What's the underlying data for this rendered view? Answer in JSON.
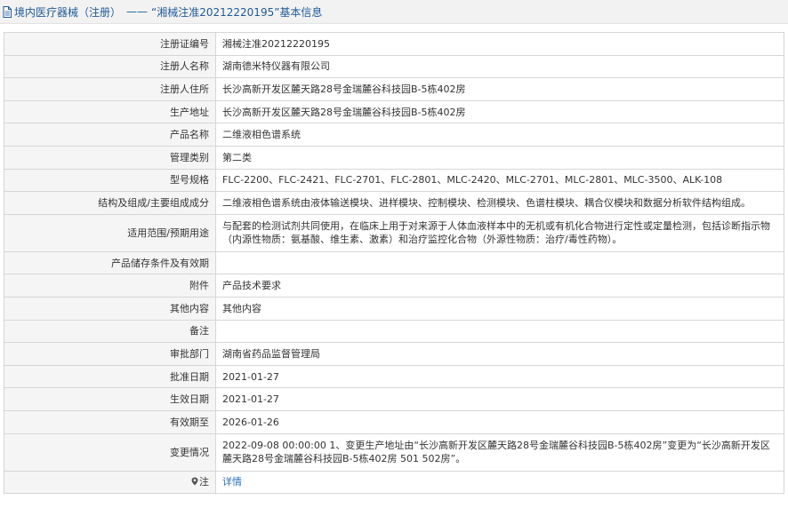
{
  "header": {
    "category": "境内医疗器械（注册）",
    "separator": "——",
    "title": "“湘械注准20212220195”基本信息"
  },
  "rows": [
    {
      "label": "注册证编号",
      "value": "湘械注准20212220195"
    },
    {
      "label": "注册人名称",
      "value": "湖南德米特仪器有限公司"
    },
    {
      "label": "注册人住所",
      "value": "长沙高新开发区麓天路28号金瑞麓谷科技园B-5栋402房"
    },
    {
      "label": "生产地址",
      "value": "长沙高新开发区麓天路28号金瑞麓谷科技园B-5栋402房"
    },
    {
      "label": "产品名称",
      "value": "二维液相色谱系统"
    },
    {
      "label": "管理类别",
      "value": "第二类"
    },
    {
      "label": "型号规格",
      "value": "FLC-2200、FLC-2421、FLC-2701、FLC-2801、MLC-2420、MLC-2701、MLC-2801、MLC-3500、ALK-108"
    },
    {
      "label": "结构及组成/主要组成成分",
      "value": "二维液相色谱系统由液体输送模块、进样模块、控制模块、检测模块、色谱柱模块、耦合仪模块和数据分析软件结构组成。"
    },
    {
      "label": "适用范围/预期用途",
      "value": "与配套的检测试剂共同使用，在临床上用于对来源于人体血液样本中的无机或有机化合物进行定性或定量检测，包括诊断指示物（内源性物质：氨基酸、维生素、激素）和治疗监控化合物（外源性物质：治疗/毒性药物）。"
    },
    {
      "label": "产品储存条件及有效期",
      "value": ""
    },
    {
      "label": "附件",
      "value": "产品技术要求"
    },
    {
      "label": "其他内容",
      "value": "其他内容"
    },
    {
      "label": "备注",
      "value": ""
    },
    {
      "label": "审批部门",
      "value": "湖南省药品监督管理局"
    },
    {
      "label": "批准日期",
      "value": "2021-01-27"
    },
    {
      "label": "生效日期",
      "value": "2021-01-27"
    },
    {
      "label": "有效期至",
      "value": "2026-01-26"
    },
    {
      "label": "变更情况",
      "value": "2022-09-08 00:00:00 1、变更生产地址由“长沙高新开发区麓天路28号金瑞麓谷科技园B-5栋402房”变更为“长沙高新开发区麓天路28号金瑞麓谷科技园B-5栋402房 501 502房”。"
    }
  ],
  "note": {
    "label": "注",
    "icon": "pin-icon",
    "link_text": "详情",
    "link_color": "#2a6fb8"
  }
}
